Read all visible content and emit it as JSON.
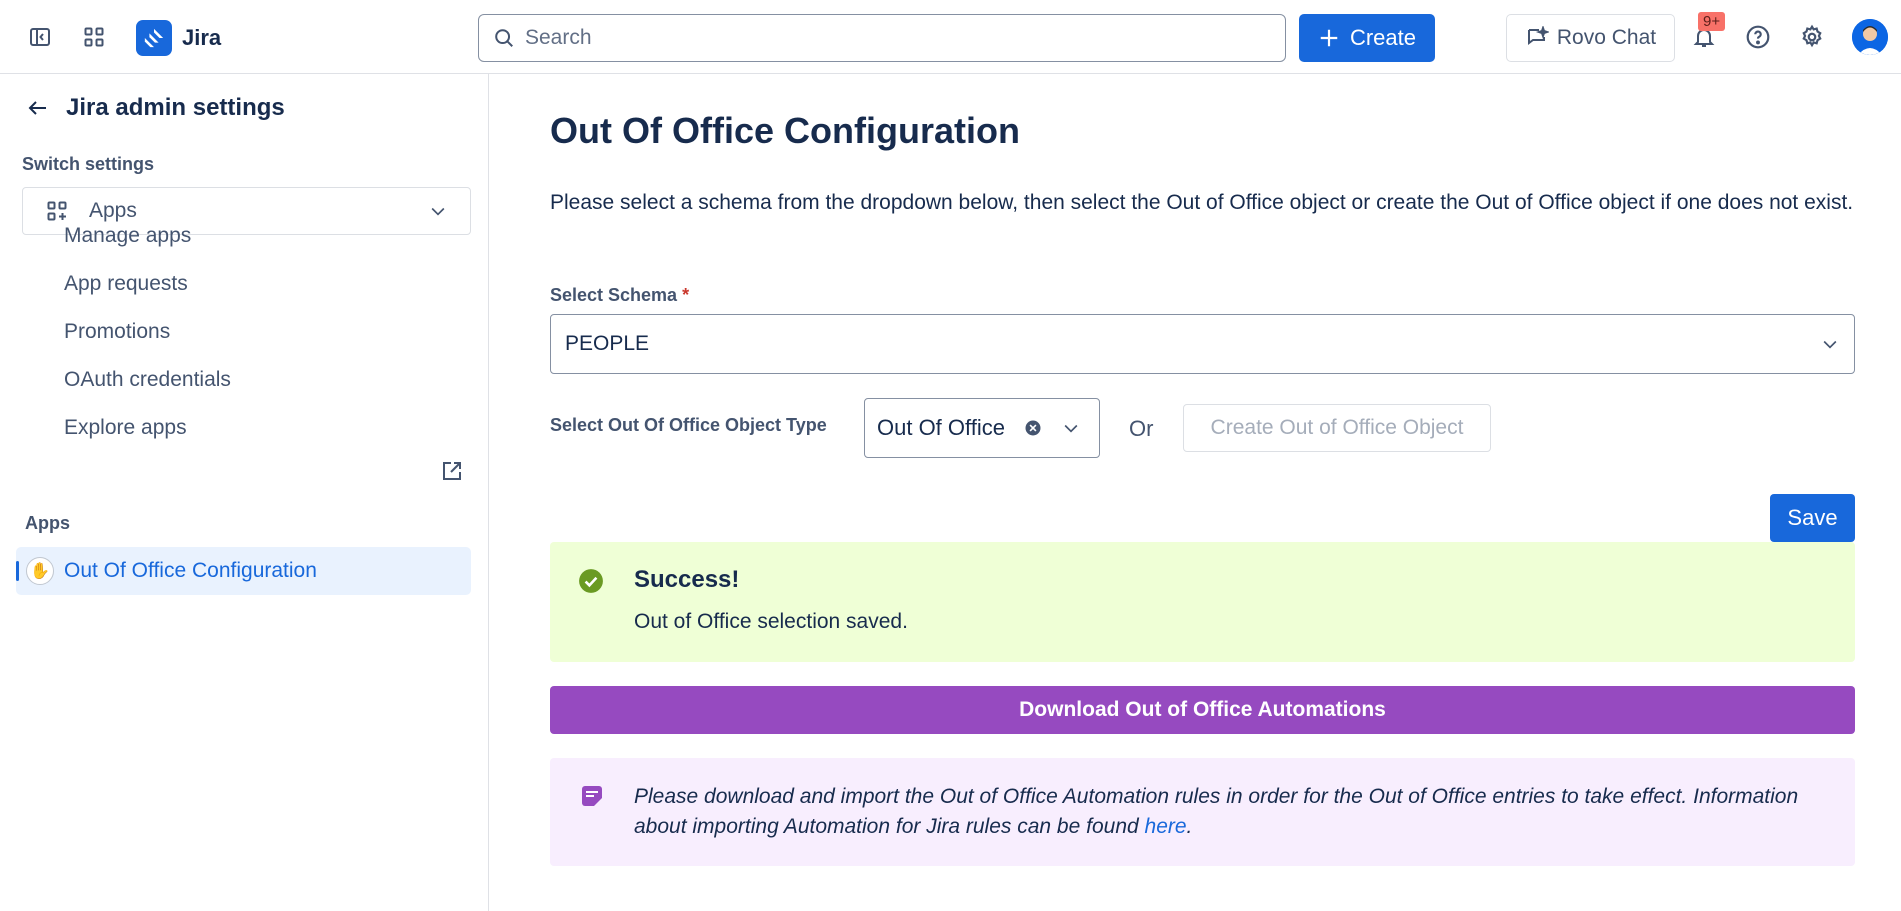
{
  "topbar": {
    "app_name": "Jira",
    "search_placeholder": "Search",
    "create_label": "Create",
    "rovo_label": "Rovo Chat",
    "notification_badge": "9+",
    "icons": [
      "sidebar-toggle-icon",
      "app-switcher-icon",
      "jira-logo-icon",
      "search-icon",
      "plus-icon",
      "rovo-chat-icon",
      "bell-icon",
      "help-icon",
      "gear-icon",
      "avatar"
    ]
  },
  "sidebar": {
    "title": "Jira admin settings",
    "switch_label": "Switch settings",
    "switch_value": "Apps",
    "items": [
      {
        "label": "Manage apps"
      },
      {
        "label": "App requests"
      },
      {
        "label": "Promotions"
      },
      {
        "label": "OAuth credentials"
      },
      {
        "label": "Explore apps"
      }
    ],
    "apps_section_label": "Apps",
    "active_item": "Out Of Office Configuration"
  },
  "main": {
    "title": "Out Of Office Configuration",
    "description": "Please select a schema from the dropdown below, then select the Out of Office object or create the Out of Office object if one does not exist.",
    "schema_label": "Select Schema",
    "required_mark": "*",
    "schema_value": "PEOPLE",
    "type_label": "Select Out Of Office Object Type",
    "type_value": "Out Of Office",
    "or_text": "Or",
    "create_object_label": "Create Out of Office Object",
    "save_label": "Save",
    "success_title": "Success!",
    "success_message": "Out of Office selection saved.",
    "download_label": "Download Out of Office Automations",
    "note_text": "Please download and import the Out of Office Automation rules in order for the Out of Office entries to take effect. Information about importing Automation for Jira rules can be found ",
    "note_link": "here",
    "note_end": "."
  },
  "colors": {
    "primary": "#1868db",
    "success_bg": "#efffd6",
    "download_purple": "#964ac0",
    "note_bg": "#f8eefe"
  }
}
